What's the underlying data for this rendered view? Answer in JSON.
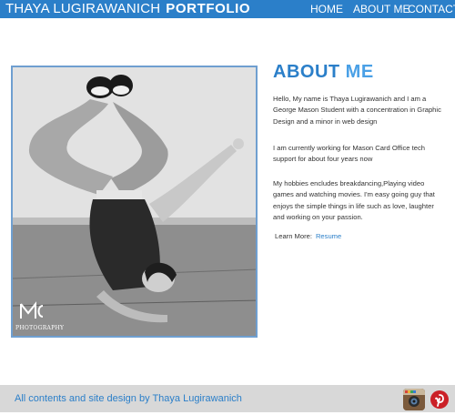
{
  "header": {
    "name": "THAYA LUGIRAWANICH",
    "portfolio": "PORTFOLIO",
    "nav": {
      "home": "HOME",
      "about": "ABOUT ME",
      "contact": "CONTACT"
    }
  },
  "photo": {
    "logo_caption": "PHOTOGRAPHY"
  },
  "about": {
    "title_about": "ABOUT",
    "title_me": "ME",
    "paragraphs": [
      "Hello, My name is Thaya Lugirawanich and I am a George Mason  Student with a concentration in Graphic Design and a minor in web design",
      "I am currently working for Mason Card Office tech support for about four years now",
      "My hobbies encludes breakdancing,Playing video games and watching movies.  I'm easy going guy that enjoys the simple things in life such as love, laughter and working on your passion."
    ],
    "learn_more_label": "Learn More:",
    "resume_link": "Resume"
  },
  "footer": {
    "text": "All contents and site design by Thaya Lugirawanich"
  },
  "colors": {
    "brand_blue": "#2b7fc9",
    "light_blue": "#4aa0e6",
    "footer_bg": "#d8d8d8"
  },
  "icons": [
    "instagram-icon",
    "pinterest-icon"
  ]
}
